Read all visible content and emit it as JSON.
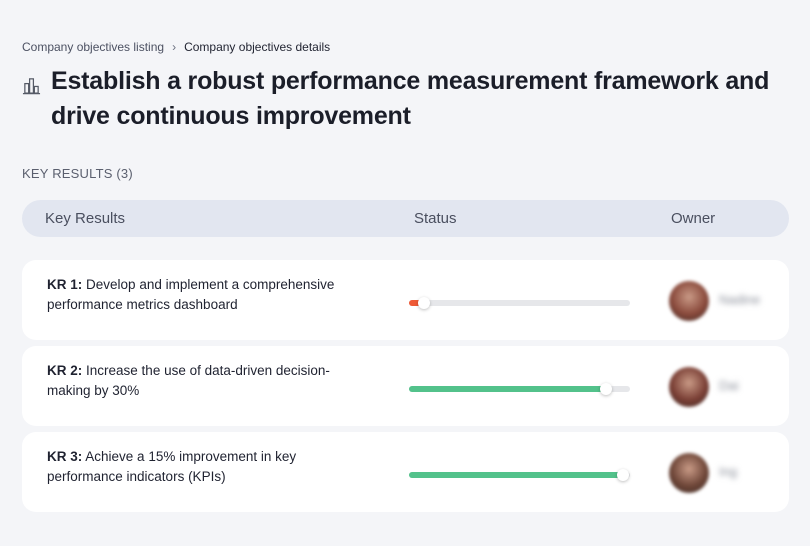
{
  "breadcrumb": {
    "parent": "Company objectives listing",
    "separator": "›",
    "current": "Company objectives details"
  },
  "objective": {
    "icon": "building-chart-icon",
    "title": "Establish a robust performance measurement framework and drive continuous improvement"
  },
  "key_results_section": {
    "label": "KEY RESULTS (3)"
  },
  "table": {
    "columns": {
      "key_results": "Key Results",
      "status": "Status",
      "owner": "Owner"
    },
    "rows": [
      {
        "code": "KR 1:",
        "text": "Develop and implement a comprehensive performance metrics dashboard",
        "progress": 0.07,
        "progress_color": "#ee5a36",
        "owner": "Nadine",
        "avatar_color": "#8a4a3c"
      },
      {
        "code": "KR 2:",
        "text": "Increase the use of data-driven decision-making by 30%",
        "progress": 0.89,
        "progress_color": "#53c28b",
        "owner": "Dai",
        "avatar_color": "#7a3f35"
      },
      {
        "code": "KR 3:",
        "text": "Achieve a 15% improvement in key performance indicators (KPIs)",
        "progress": 0.97,
        "progress_color": "#53c28b",
        "owner": "Ing",
        "avatar_color": "#6e4638"
      }
    ]
  }
}
